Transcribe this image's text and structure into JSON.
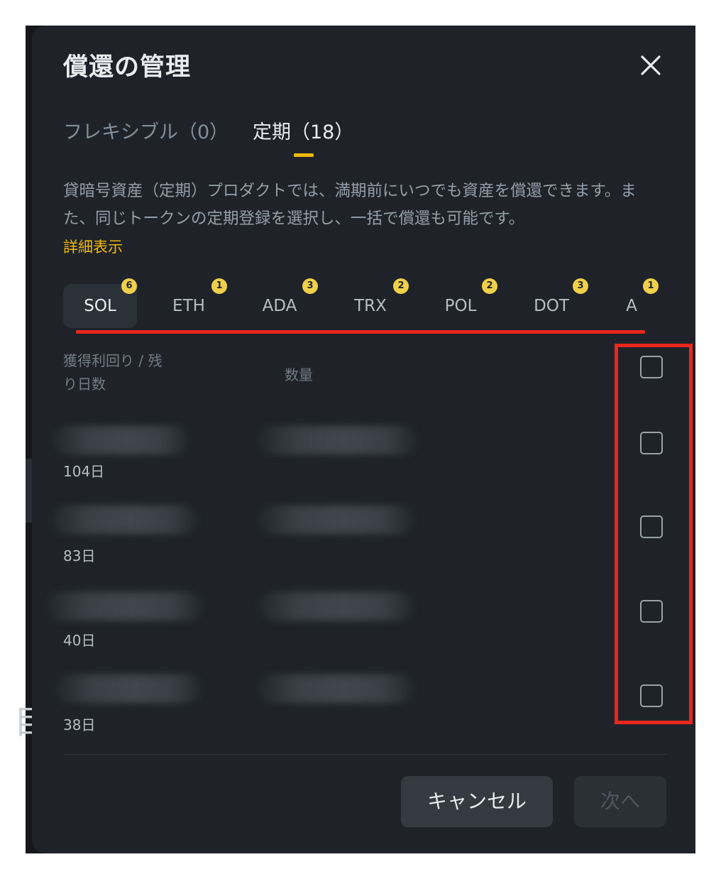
{
  "modal": {
    "title": "償還の管理",
    "tabs": [
      {
        "label": "フレキシブル（0）",
        "active": false
      },
      {
        "label": "定期（18）",
        "active": true
      }
    ],
    "description": "貸暗号資産（定期）プロダクトでは、満期前にいつでも資産を償還できます。また、同じトークンの定期登録を選択し、一括で償還も可能です。",
    "more_link": "詳細表示",
    "coins": [
      {
        "label": "SOL",
        "count": "6",
        "active": true
      },
      {
        "label": "ETH",
        "count": "1",
        "active": false
      },
      {
        "label": "ADA",
        "count": "3",
        "active": false
      },
      {
        "label": "TRX",
        "count": "2",
        "active": false
      },
      {
        "label": "POL",
        "count": "2",
        "active": false
      },
      {
        "label": "DOT",
        "count": "3",
        "active": false
      },
      {
        "label": "A",
        "count": "1",
        "active": false
      }
    ],
    "table": {
      "col_yield": "獲得利回り / 残り日数",
      "col_qty": "数量",
      "rows": [
        {
          "days": "104日"
        },
        {
          "days": "83日"
        },
        {
          "days": "40日"
        },
        {
          "days": "38日"
        }
      ]
    },
    "buttons": {
      "cancel": "キャンセル",
      "next": "次へ"
    }
  },
  "colors": {
    "accent": "#f0b90b",
    "highlight": "#e9271b",
    "surface": "#1f2329"
  }
}
